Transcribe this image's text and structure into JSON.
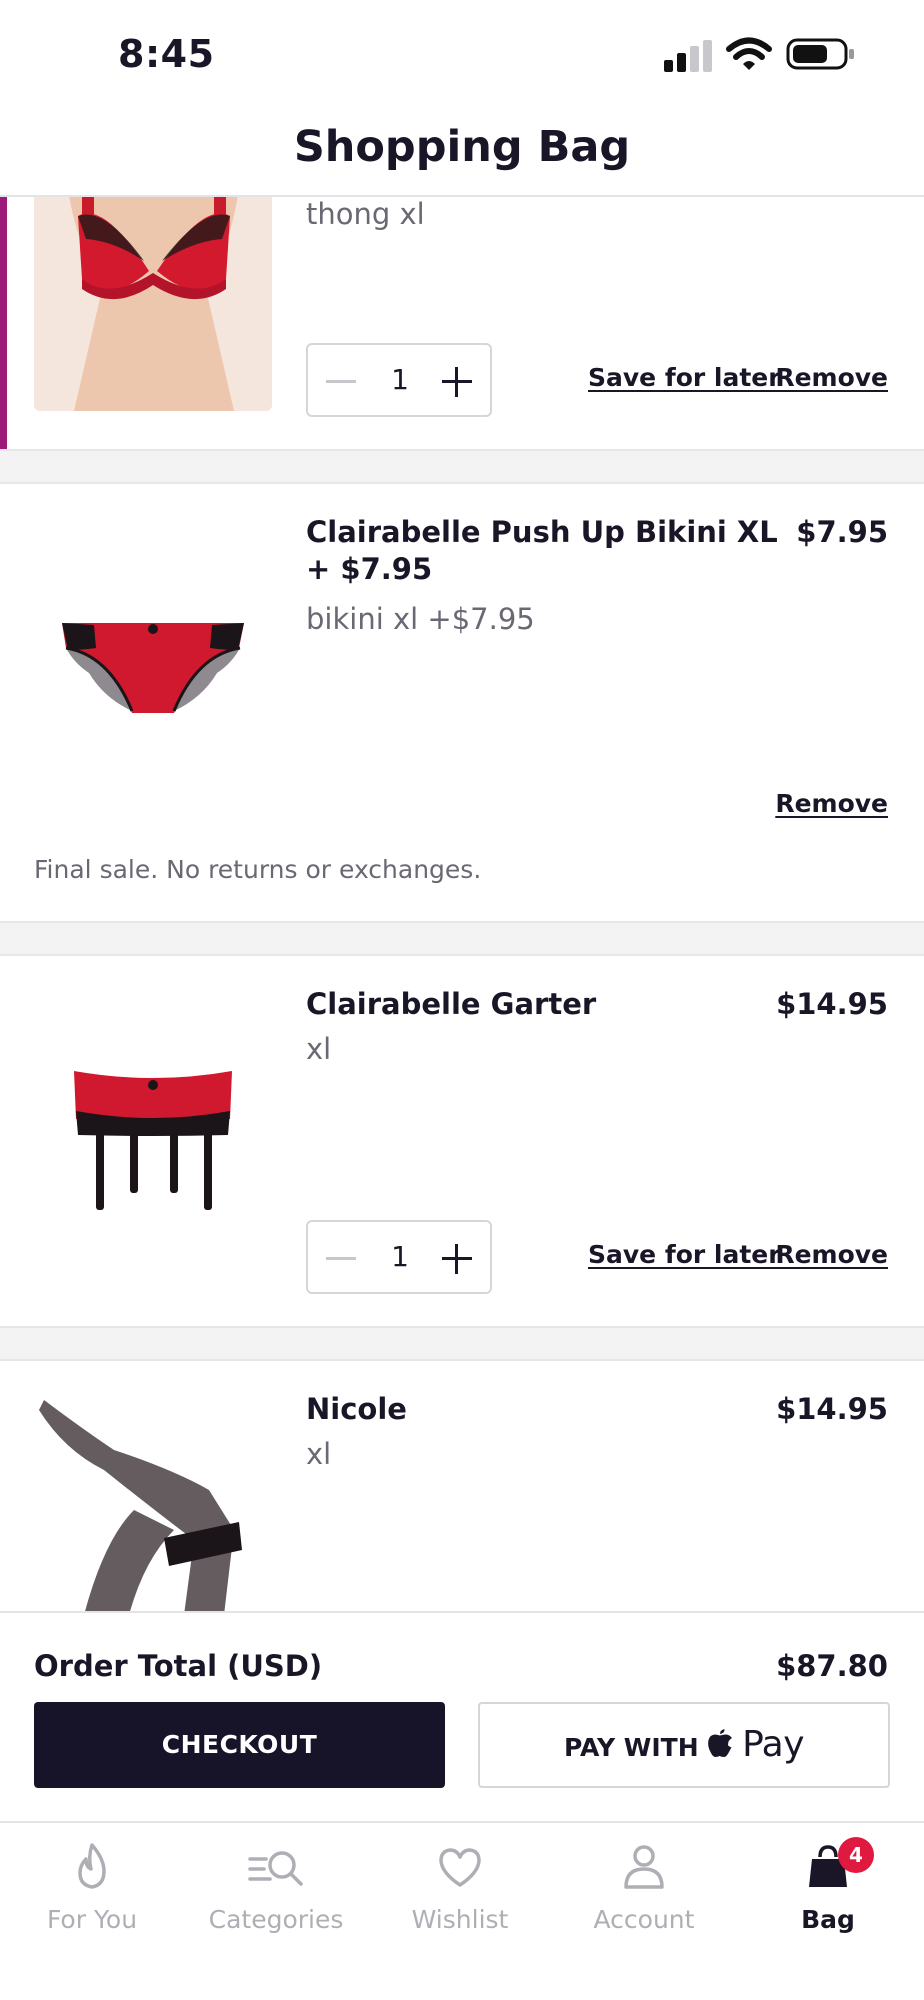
{
  "status_bar": {
    "time": "8:45"
  },
  "header": {
    "title": "Shopping Bag"
  },
  "items": [
    {
      "name": "",
      "variant": "thong xl",
      "quantity": "1",
      "save_label": "Save for later",
      "remove_label": "Remove"
    },
    {
      "name": "Clairabelle Push Up Bikini XL + $7.95",
      "price": "$7.95",
      "variant": "bikini xl +$7.95",
      "remove_label": "Remove",
      "note": "Final sale. No returns or exchanges."
    },
    {
      "name": "Clairabelle Garter",
      "price": "$14.95",
      "variant": "xl",
      "quantity": "1",
      "save_label": "Save for later",
      "remove_label": "Remove"
    },
    {
      "name": "Nicole",
      "price": "$14.95",
      "variant": "xl"
    }
  ],
  "order": {
    "total_label": "Order Total (USD)",
    "total_value": "$87.80",
    "checkout_label": "CHECKOUT",
    "applepay_prefix": "PAY WITH",
    "applepay_pay": "Pay"
  },
  "tabbar": {
    "tabs": [
      {
        "label": "For You",
        "icon": "flame-icon"
      },
      {
        "label": "Categories",
        "icon": "categories-search-icon"
      },
      {
        "label": "Wishlist",
        "icon": "heart-icon"
      },
      {
        "label": "Account",
        "icon": "person-icon"
      },
      {
        "label": "Bag",
        "icon": "bag-icon",
        "badge": "4",
        "active": true
      }
    ]
  },
  "colors": {
    "accent": "#9c1a7a",
    "primary": "#171429",
    "badge": "#e0193f",
    "product_red": "#d0192e"
  }
}
